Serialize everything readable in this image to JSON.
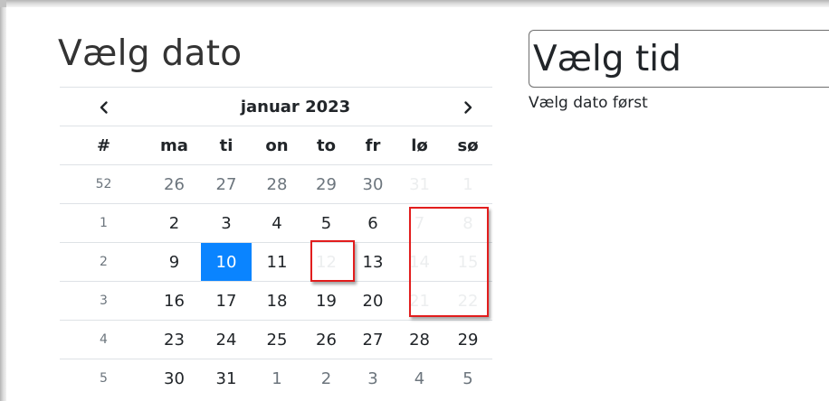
{
  "colors": {
    "accent": "#0a84ff",
    "highlight": "#e21d1d",
    "disabled_text": "#eceeef",
    "muted_text": "#6c757d"
  },
  "date_picker": {
    "title": "Vælg dato",
    "month_label": "januar 2023",
    "prev_icon": "chevron-left-icon",
    "next_icon": "chevron-right-icon",
    "week_header": "#",
    "weekdays": [
      "ma",
      "ti",
      "on",
      "to",
      "fr",
      "lø",
      "sø"
    ],
    "weeks": [
      {
        "week": "52",
        "days": [
          {
            "d": "26",
            "state": "other"
          },
          {
            "d": "27",
            "state": "other"
          },
          {
            "d": "28",
            "state": "other"
          },
          {
            "d": "29",
            "state": "other"
          },
          {
            "d": "30",
            "state": "other"
          },
          {
            "d": "31",
            "state": "disabled"
          },
          {
            "d": "1",
            "state": "disabled"
          }
        ]
      },
      {
        "week": "1",
        "days": [
          {
            "d": "2",
            "state": "normal"
          },
          {
            "d": "3",
            "state": "normal"
          },
          {
            "d": "4",
            "state": "normal"
          },
          {
            "d": "5",
            "state": "normal"
          },
          {
            "d": "6",
            "state": "normal"
          },
          {
            "d": "7",
            "state": "disabled"
          },
          {
            "d": "8",
            "state": "disabled"
          }
        ]
      },
      {
        "week": "2",
        "days": [
          {
            "d": "9",
            "state": "normal"
          },
          {
            "d": "10",
            "state": "active"
          },
          {
            "d": "11",
            "state": "normal"
          },
          {
            "d": "12",
            "state": "disabled"
          },
          {
            "d": "13",
            "state": "normal"
          },
          {
            "d": "14",
            "state": "disabled"
          },
          {
            "d": "15",
            "state": "disabled"
          }
        ]
      },
      {
        "week": "3",
        "days": [
          {
            "d": "16",
            "state": "normal"
          },
          {
            "d": "17",
            "state": "normal"
          },
          {
            "d": "18",
            "state": "normal"
          },
          {
            "d": "19",
            "state": "normal"
          },
          {
            "d": "20",
            "state": "normal"
          },
          {
            "d": "21",
            "state": "disabled"
          },
          {
            "d": "22",
            "state": "disabled"
          }
        ]
      },
      {
        "week": "4",
        "days": [
          {
            "d": "23",
            "state": "normal"
          },
          {
            "d": "24",
            "state": "normal"
          },
          {
            "d": "25",
            "state": "normal"
          },
          {
            "d": "26",
            "state": "normal"
          },
          {
            "d": "27",
            "state": "normal"
          },
          {
            "d": "28",
            "state": "normal"
          },
          {
            "d": "29",
            "state": "normal"
          }
        ]
      },
      {
        "week": "5",
        "days": [
          {
            "d": "30",
            "state": "normal"
          },
          {
            "d": "31",
            "state": "normal"
          },
          {
            "d": "1",
            "state": "other"
          },
          {
            "d": "2",
            "state": "other"
          },
          {
            "d": "3",
            "state": "other"
          },
          {
            "d": "4",
            "state": "other"
          },
          {
            "d": "5",
            "state": "other"
          }
        ]
      }
    ]
  },
  "time_picker": {
    "value": "Vælg tid",
    "hint": "Vælg dato først"
  }
}
